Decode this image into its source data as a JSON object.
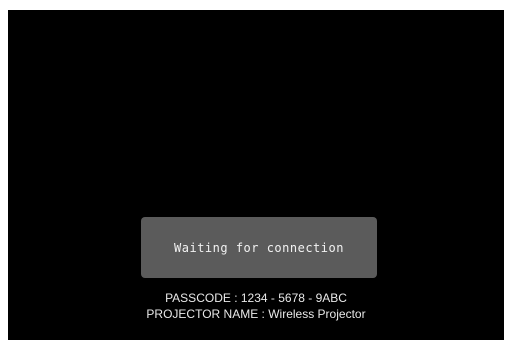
{
  "status": {
    "message": "Waiting for connection"
  },
  "connection_info": {
    "passcode_label": "PASSCODE : ",
    "passcode_value": "1234 - 5678 - 9ABC",
    "projector_name_label": "PROJECTOR NAME : ",
    "projector_name_value": "Wireless Projector"
  },
  "colors": {
    "background": "#000000",
    "status_box": "#5b5b5b",
    "text": "#e8e8e8"
  }
}
